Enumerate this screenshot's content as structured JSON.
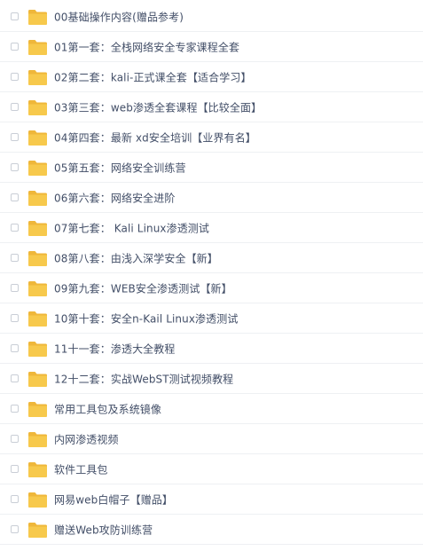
{
  "folders": [
    {
      "name": "00基础操作内容(赠品参考)"
    },
    {
      "name": "01第一套：全栈网络安全专家课程全套"
    },
    {
      "name": "02第二套：kali-正式课全套【适合学习】"
    },
    {
      "name": "03第三套：web渗透全套课程【比较全面】"
    },
    {
      "name": "04第四套：最新 xd安全培训【业界有名】"
    },
    {
      "name": "05第五套：网络安全训练营"
    },
    {
      "name": "06第六套：网络安全进阶"
    },
    {
      "name": "07第七套： Kali Linux渗透测试"
    },
    {
      "name": "08第八套：由浅入深学安全【新】"
    },
    {
      "name": "09第九套：WEB安全渗透测试【新】"
    },
    {
      "name": "10第十套：安全n-Kail Linux渗透测试"
    },
    {
      "name": "11十一套：渗透大全教程"
    },
    {
      "name": "12十二套：实战WebST测试视频教程"
    },
    {
      "name": "常用工具包及系统镜像"
    },
    {
      "name": "内网渗透视频"
    },
    {
      "name": "软件工具包"
    },
    {
      "name": "网易web白帽子【赠品】"
    },
    {
      "name": "赠送Web攻防训练营"
    }
  ],
  "colors": {
    "folder": "#f7c94c",
    "folder_dark": "#efb73a",
    "text": "#424e67",
    "divider": "#eef0f3"
  },
  "icons": {
    "row_icon": "folder-icon",
    "select": "checkbox"
  }
}
